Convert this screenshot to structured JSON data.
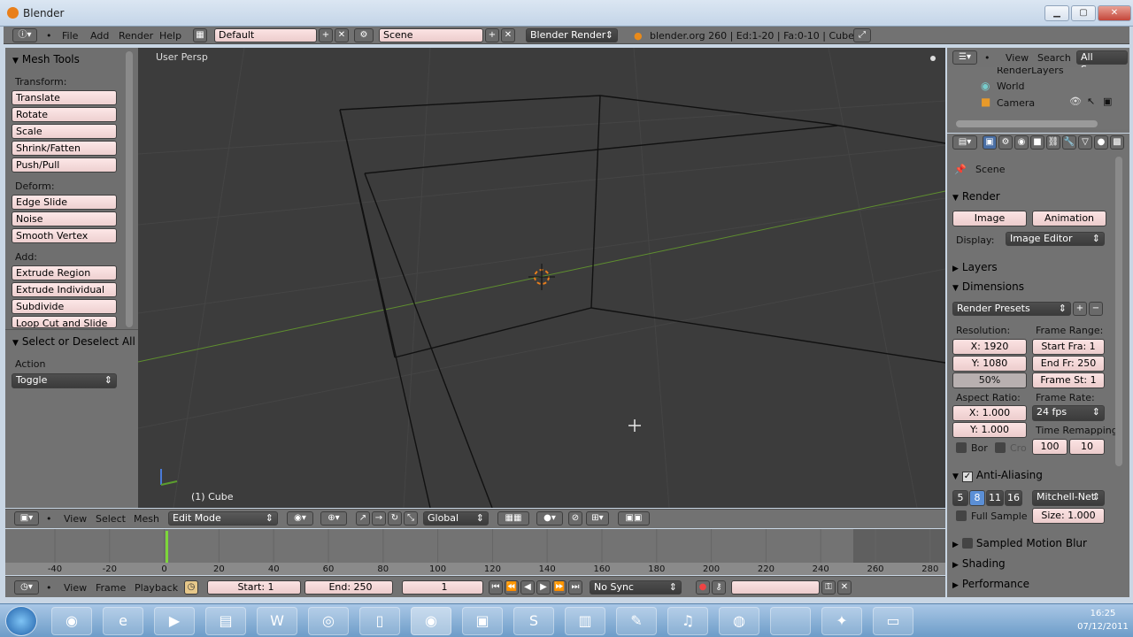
{
  "window": {
    "title": "Blender"
  },
  "header": {
    "menus": [
      "File",
      "Add",
      "Render",
      "Help"
    ],
    "layout": "Default",
    "scene": "Scene",
    "engine": "Blender Render",
    "stats": "blender.org 260 | Ed:1-20 | Fa:0-10 | Cube"
  },
  "tools": {
    "title": "Mesh Tools",
    "transform_label": "Transform:",
    "transform": [
      "Translate",
      "Rotate",
      "Scale",
      "Shrink/Fatten",
      "Push/Pull"
    ],
    "deform_label": "Deform:",
    "deform": [
      "Edge Slide",
      "Noise",
      "Smooth Vertex"
    ],
    "add_label": "Add:",
    "add": [
      "Extrude Region",
      "Extrude Individual",
      "Subdivide",
      "Loop Cut and Slide"
    ],
    "operator_title": "Select or Deselect All",
    "action_label": "Action",
    "action_value": "Toggle"
  },
  "viewport": {
    "view_name": "User Persp",
    "object_label": "(1) Cube"
  },
  "view3d_header": {
    "menus": [
      "View",
      "Select",
      "Mesh"
    ],
    "mode": "Edit Mode",
    "orientation": "Global"
  },
  "timeline": {
    "ticks": [
      "-40",
      "-20",
      "0",
      "20",
      "40",
      "60",
      "80",
      "100",
      "120",
      "140",
      "160",
      "180",
      "200",
      "220",
      "240",
      "260",
      "280"
    ],
    "menus": [
      "View",
      "Frame",
      "Playback"
    ],
    "start": "Start: 1",
    "end": "End: 250",
    "current": "1",
    "sync": "No Sync"
  },
  "outliner": {
    "menus": [
      "View",
      "Search"
    ],
    "filter": "All Scenes",
    "items": [
      "RenderLayers",
      "World",
      "Camera"
    ]
  },
  "properties": {
    "context": "Scene",
    "render_panel": "Render",
    "image_btn": "Image",
    "animation_btn": "Animation",
    "display_label": "Display:",
    "display_value": "Image Editor",
    "layers_panel": "Layers",
    "dimensions_panel": "Dimensions",
    "presets": "Render Presets",
    "resolution_label": "Resolution:",
    "res_x": "X: 1920",
    "res_y": "Y: 1080",
    "res_pct": "50%",
    "frame_range_label": "Frame Range:",
    "start_frame": "Start Fra: 1",
    "end_frame": "End Fr: 250",
    "frame_step": "Frame St: 1",
    "aspect_label": "Aspect Ratio:",
    "aspect_x": "X: 1.000",
    "aspect_y": "Y: 1.000",
    "frame_rate_label": "Frame Rate:",
    "fps": "24 fps",
    "remap_label": "Time Remapping",
    "remap_old": "100",
    "remap_new": "10",
    "bor": "Bor",
    "cro": "Cro",
    "aa_panel": "Anti-Aliasing",
    "aa_samples": [
      "5",
      "8",
      "11",
      "16"
    ],
    "aa_filter": "Mitchell-Net",
    "full_sample": "Full Sample",
    "aa_size": "Size: 1.000",
    "motion_blur_panel": "Sampled Motion Blur",
    "shading_panel": "Shading",
    "performance_panel": "Performance"
  },
  "taskbar": {
    "apps": [
      "chrome-icon",
      "ie-icon",
      "media-icon",
      "folder-icon",
      "word-icon",
      "firefox-icon",
      "files-icon",
      "blender-icon",
      "tv-icon",
      "skype-icon",
      "explorer-icon",
      "paint-icon",
      "itunes-icon",
      "webcam-icon",
      "blank-icon",
      "tool-icon",
      "window-icon"
    ],
    "clock_time": "16:25",
    "clock_date": "07/12/2011"
  }
}
